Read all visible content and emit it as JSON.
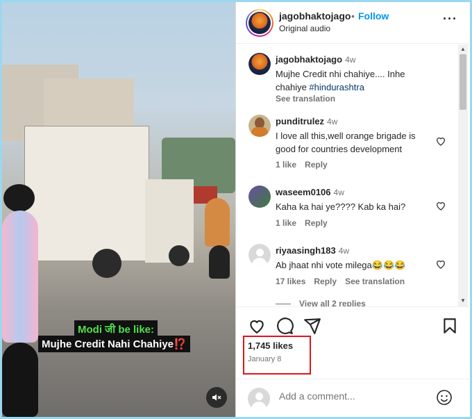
{
  "video": {
    "caption_line1": "Modi जी be like:",
    "caption_line2": "Mujhe Credit Nahi Chahiye⁉️"
  },
  "header": {
    "username": "jagobhaktojago",
    "dot": "•",
    "follow_label": "Follow",
    "audio_label": "Original audio",
    "more_glyph": "···"
  },
  "comments": [
    {
      "username": "jagobhaktojago",
      "time": "4w",
      "text_before": "Mujhe Credit nhi chahiye.... Inhe chahiye ",
      "hashtag": "#hindurashtra",
      "see_translation": "See translation"
    },
    {
      "username": "punditrulez",
      "time": "4w",
      "text": "I love all this,well orange brigade is good for countries development",
      "likes": "1 like",
      "reply": "Reply"
    },
    {
      "username": "waseem0106",
      "time": "4w",
      "text": "Kaha ka hai ye???? Kab ka hai?",
      "likes": "1 like",
      "reply": "Reply"
    },
    {
      "username": "riyaasingh183",
      "time": "4w",
      "text": "Ab jhaat nhi vote milega😂😂😂",
      "likes": "17 likes",
      "reply": "Reply",
      "see_translation": "See translation",
      "view_replies": "View all 2 replies"
    }
  ],
  "post": {
    "likes": "1,745 likes",
    "date": "January 8"
  },
  "add_comment": {
    "placeholder": "Add a comment..."
  },
  "icons": {
    "like": "heart-icon",
    "comment": "comment-icon",
    "share": "share-icon",
    "save": "bookmark-icon",
    "emoji": "emoji-icon",
    "mute": "mute-icon",
    "more": "more-icon"
  },
  "colors": {
    "follow": "#0095f6",
    "highlight_box": "#e0131a",
    "caption_green": "#52e04f",
    "frame_border": "#9bd8ef"
  }
}
